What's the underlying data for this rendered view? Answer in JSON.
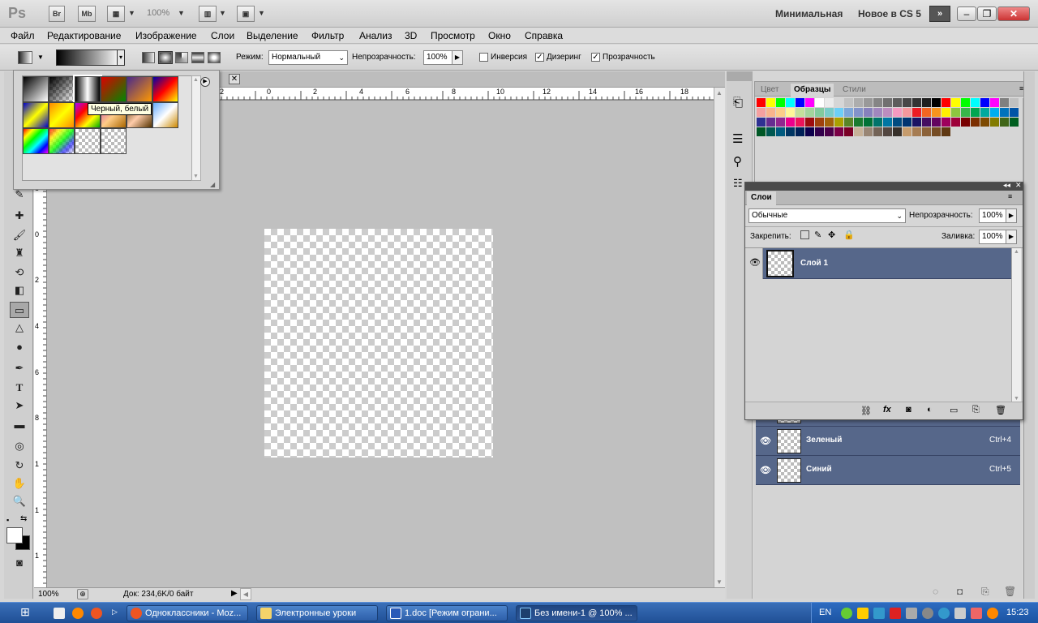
{
  "appbar": {
    "logo": "Ps",
    "bridge": "Br",
    "minibridge": "Mb",
    "zoom": "100%",
    "workspace_minimal": "Минимальная",
    "workspace_new": "Новое в CS 5"
  },
  "menu": [
    "Файл",
    "Редактирование",
    "Изображение",
    "Слои",
    "Выделение",
    "Фильтр",
    "Анализ",
    "3D",
    "Просмотр",
    "Окно",
    "Справка"
  ],
  "options": {
    "mode_label": "Режим:",
    "mode_value": "Нормальный",
    "opacity_label": "Непрозрачность:",
    "opacity_value": "100%",
    "reverse_label": "Инверсия",
    "dither_label": "Дизеринг",
    "transparency_label": "Прозрачность",
    "reverse_checked": false,
    "dither_checked": true,
    "transparency_checked": true
  },
  "gradient_picker": {
    "tooltip": "Черный, белый"
  },
  "ruler": {
    "h_ticks": [
      "2",
      "0",
      "2",
      "4",
      "6",
      "8",
      "10",
      "12",
      "14",
      "16",
      "18"
    ],
    "v_ticks": [
      "8",
      "0",
      "2",
      "4",
      "6",
      "8",
      "1",
      "1",
      "1"
    ]
  },
  "status": {
    "zoom": "100%",
    "doc": "Док: 234,6K/0 байт"
  },
  "swatches_panel": {
    "tabs": [
      "Цвет",
      "Образцы",
      "Стили"
    ],
    "active_tab": "Образцы",
    "colors": [
      "#ff0000",
      "#ffff00",
      "#00ff00",
      "#00ffff",
      "#0000ff",
      "#ff00ff",
      "#ffffff",
      "#ebebeb",
      "#d6d6d6",
      "#c2c2c2",
      "#adadad",
      "#999999",
      "#858585",
      "#707070",
      "#5c5c5c",
      "#474747",
      "#333333",
      "#1f1f1f",
      "#000000",
      "#ff0000",
      "#ffff00",
      "#00ff00",
      "#00ffff",
      "#0000ff",
      "#ff00ff",
      "#808080",
      "#c0c0c0",
      "#f4a0a0",
      "#f8b48c",
      "#fbce89",
      "#fff799",
      "#c4df9b",
      "#a3d39c",
      "#82ca9d",
      "#7accc8",
      "#6dcff6",
      "#7da7d9",
      "#8393ca",
      "#8781bd",
      "#a187be",
      "#bc8dbf",
      "#f49ac1",
      "#f5989d",
      "#ed1c24",
      "#f26522",
      "#f7941d",
      "#fff200",
      "#8dc63f",
      "#39b54a",
      "#00a651",
      "#00a99d",
      "#00aeef",
      "#0072bc",
      "#0054a6",
      "#2e3192",
      "#662d91",
      "#92278f",
      "#ec008c",
      "#ed145b",
      "#9e0b0f",
      "#a0410d",
      "#a3620a",
      "#aba000",
      "#598527",
      "#1a7b30",
      "#007236",
      "#00746b",
      "#0076a3",
      "#004b80",
      "#003471",
      "#1b1464",
      "#440e62",
      "#630460",
      "#9e005d",
      "#9e0039",
      "#790000",
      "#7b2e00",
      "#7d4900",
      "#827b00",
      "#406618",
      "#005e20",
      "#005826",
      "#005952",
      "#005b7f",
      "#003663",
      "#002157",
      "#0d004c",
      "#32004b",
      "#4b0049",
      "#7b0046",
      "#7a0026",
      "#c7b299",
      "#998675",
      "#736357",
      "#534741",
      "#37302a",
      "#c69c6d",
      "#a67c52",
      "#8c6239",
      "#754c24",
      "#603913"
    ]
  },
  "layers_panel": {
    "title": "Слои",
    "blend": "Обычные",
    "opacity_label": "Непрозрачность:",
    "opacity_value": "100%",
    "lock_label": "Закрепить:",
    "fill_label": "Заливка:",
    "fill_value": "100%",
    "layer_name": "Слой 1"
  },
  "channels": [
    {
      "name": "Зеленый",
      "shortcut": "Ctrl+4"
    },
    {
      "name": "Синий",
      "shortcut": "Ctrl+5"
    }
  ],
  "taskbar": {
    "items": [
      {
        "label": "Одноклассники - Moz...",
        "active": false
      },
      {
        "label": "Электронные уроки",
        "active": false
      },
      {
        "label": "1.doc [Режим ограни...",
        "active": false
      },
      {
        "label": "Без имени-1 @ 100% ...",
        "active": true
      }
    ],
    "lang": "EN",
    "time": "15:23"
  }
}
